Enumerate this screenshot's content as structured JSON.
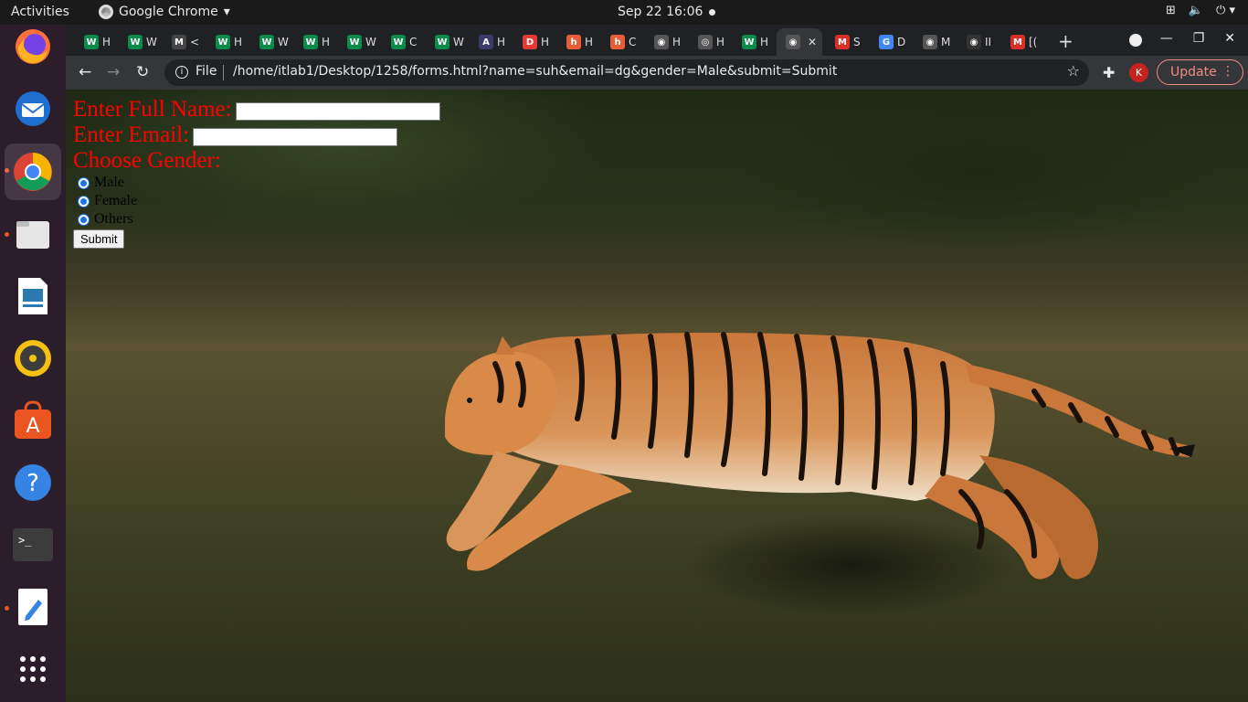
{
  "system": {
    "activities": "Activities",
    "app_name": "Google Chrome",
    "clock": "Sep 22  16:06"
  },
  "browser": {
    "tabs": [
      {
        "fav": "W",
        "label": "H",
        "color": "#0a8a4b"
      },
      {
        "fav": "W",
        "label": "W",
        "color": "#0a8a4b"
      },
      {
        "fav": "M",
        "label": "<",
        "color": "#444444"
      },
      {
        "fav": "W",
        "label": "H",
        "color": "#0a8a4b"
      },
      {
        "fav": "W",
        "label": "W",
        "color": "#0a8a4b"
      },
      {
        "fav": "W",
        "label": "H",
        "color": "#0a8a4b"
      },
      {
        "fav": "W",
        "label": "W",
        "color": "#0a8a4b"
      },
      {
        "fav": "W",
        "label": "C",
        "color": "#0a8a4b"
      },
      {
        "fav": "W",
        "label": "W",
        "color": "#0a8a4b"
      },
      {
        "fav": "A",
        "label": "H",
        "color": "#3b3b6b"
      },
      {
        "fav": "D",
        "label": "H",
        "color": "#e53935"
      },
      {
        "fav": "h",
        "label": "H",
        "color": "#e85d3a"
      },
      {
        "fav": "h",
        "label": "C",
        "color": "#e85d3a"
      },
      {
        "fav": "◉",
        "label": "H",
        "color": "#555555"
      },
      {
        "fav": "◎",
        "label": "H",
        "color": "#555555"
      },
      {
        "fav": "W",
        "label": "H",
        "color": "#0a8a4b"
      },
      {
        "fav": "◉",
        "label": "",
        "color": "#555555",
        "active": true
      },
      {
        "fav": "M",
        "label": "S",
        "color": "#d93025"
      },
      {
        "fav": "G",
        "label": "D",
        "color": "#4285f4"
      },
      {
        "fav": "◉",
        "label": "M",
        "color": "#555555"
      },
      {
        "fav": "◉",
        "label": "II",
        "color": "#333333"
      },
      {
        "fav": "M",
        "label": "[(",
        "color": "#d93025"
      }
    ],
    "url_scheme": "File",
    "url": "/home/itlab1/Desktop/1258/forms.html?name=suh&email=dg&gender=Male&submit=Submit",
    "profile_initial": "K",
    "update_label": "Update"
  },
  "form": {
    "name_label": "Enter Full Name:",
    "email_label": "Enter Email:",
    "gender_label": "Choose Gender:",
    "options": [
      "Male",
      "Female",
      "Others"
    ],
    "submit_label": "Submit"
  }
}
